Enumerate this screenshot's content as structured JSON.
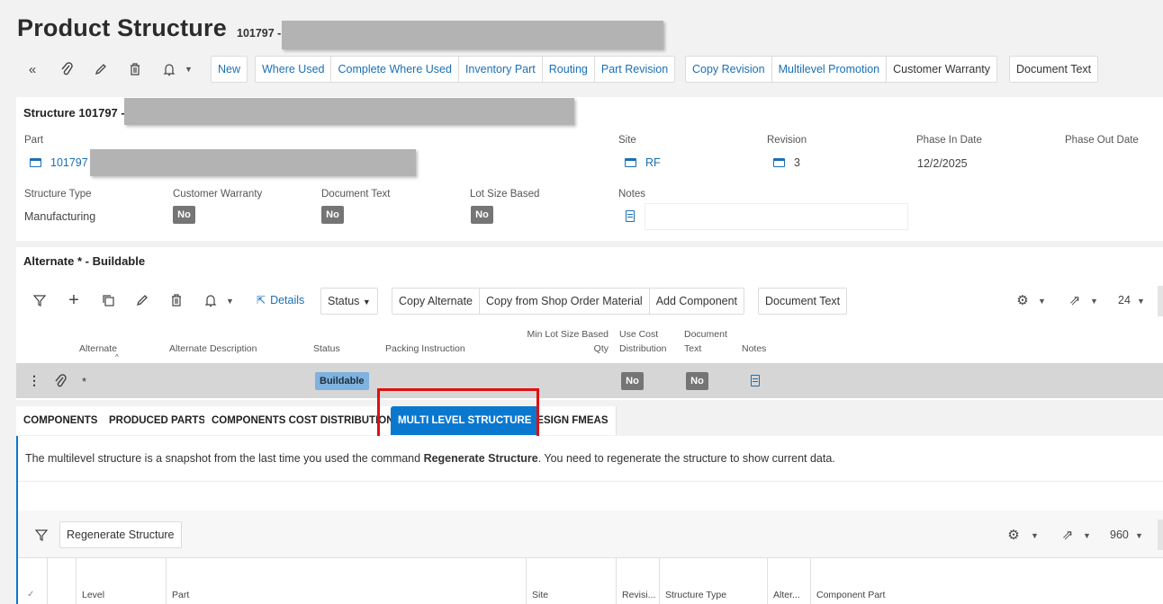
{
  "page": {
    "title": "Product Structure",
    "subtitle": "101797 -"
  },
  "toolbar": {
    "icons": [
      "collapse-icon",
      "attachment-icon",
      "edit-icon",
      "delete-icon",
      "bell-icon"
    ],
    "group1": [
      "New"
    ],
    "group2": [
      "Where Used",
      "Complete Where Used",
      "Inventory Part",
      "Routing",
      "Part Revision"
    ],
    "group3": [
      "Copy Revision",
      "Multilevel Promotion",
      "Customer Warranty"
    ],
    "document_text": "Document Text"
  },
  "structure": {
    "title": "Structure 101797 -",
    "part_label": "Part",
    "part_value": "101797 -",
    "site_label": "Site",
    "site_value": "RF",
    "revision_label": "Revision",
    "revision_value": "3",
    "phase_in_label": "Phase In Date",
    "phase_in_value": "12/2/2025",
    "phase_out_label": "Phase Out Date",
    "structure_type_label": "Structure Type",
    "structure_type_value": "Manufacturing",
    "customer_warranty_label": "Customer Warranty",
    "customer_warranty_value": "No",
    "document_text_label": "Document Text",
    "document_text_value": "No",
    "lot_size_label": "Lot Size Based",
    "lot_size_value": "No",
    "notes_label": "Notes"
  },
  "alternate": {
    "title": "Alternate * - Buildable",
    "details": "Details",
    "status_button": "Status",
    "buttons": [
      "Copy Alternate",
      "Copy from Shop Order Material",
      "Add Component"
    ],
    "document_text": "Document Text",
    "page_size": "24",
    "columns": {
      "alternate": "Alternate",
      "alternate_description": "Alternate Description",
      "status": "Status",
      "packing_instruction": "Packing Instruction",
      "min_lot_1": "Min Lot Size Based",
      "min_lot_2": "Qty",
      "use_cost_1": "Use Cost",
      "use_cost_2": "Distribution",
      "doc_text_1": "Document",
      "doc_text_2": "Text",
      "notes": "Notes"
    },
    "row": {
      "alternate": "*",
      "status": "Buildable",
      "use_cost": "No",
      "document_text": "No"
    }
  },
  "tabs": [
    "COMPONENTS",
    "PRODUCED PARTS",
    "COMPONENTS COST DISTRIBUTION",
    "MULTI LEVEL STRUCTURE",
    "DESIGN FMEAS"
  ],
  "multilevel": {
    "info_prefix": "The multilevel structure is a snapshot from the last time you used the command ",
    "info_bold": "Regenerate Structure",
    "info_suffix": ". You need to regenerate the structure to show current data.",
    "regenerate_button": "Regenerate Structure",
    "page_size": "960",
    "columns": [
      "Level",
      "Part",
      "Site",
      "Revisi...",
      "Structure Type",
      "Alter...",
      "Component Part"
    ]
  },
  "colors": {
    "accent": "#0b78d0",
    "link": "#1a6fb5",
    "highlight_box": "#e01010",
    "badge_grey": "#757575",
    "status_badge": "#7fb2de"
  }
}
